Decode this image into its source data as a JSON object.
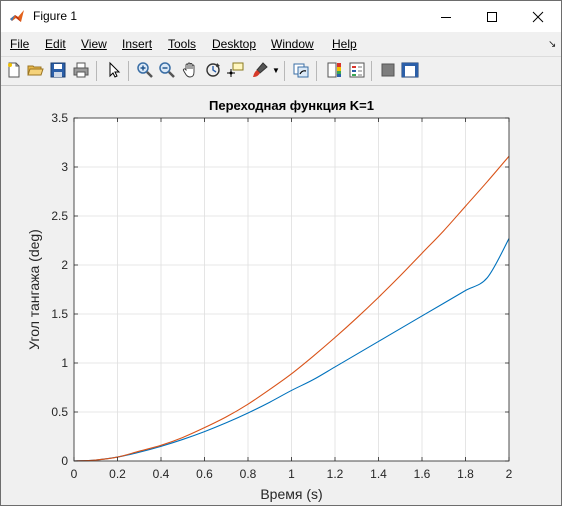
{
  "window": {
    "title": "Figure 1"
  },
  "menu": {
    "items": [
      "File",
      "Edit",
      "View",
      "Insert",
      "Tools",
      "Desktop",
      "Window",
      "Help"
    ]
  },
  "toolbar": {
    "icons": [
      "new-figure-icon",
      "open-file-icon",
      "save-icon",
      "print-icon",
      "pointer-icon",
      "zoom-in-icon",
      "zoom-out-icon",
      "pan-icon",
      "rotate-3d-icon",
      "data-cursor-icon",
      "brush-icon",
      "link-plot-icon",
      "colorbar-icon",
      "legend-icon",
      "hide-plot-tools-icon",
      "show-plot-tools-icon"
    ]
  },
  "colors": {
    "series_1": "#0072bd",
    "series_2": "#d95319",
    "grid": "#dfdfdf"
  },
  "chart_data": {
    "type": "line",
    "title": "Переходная функция K=1",
    "xlabel": "Время (s)",
    "ylabel": "Угол тангажа (deg)",
    "xlim": [
      0,
      2
    ],
    "ylim": [
      0,
      3.5
    ],
    "xticks": [
      "0",
      "0.2",
      "0.4",
      "0.6",
      "0.8",
      "1",
      "1.2",
      "1.4",
      "1.6",
      "1.8",
      "2"
    ],
    "yticks": [
      "0",
      "0.5",
      "1",
      "1.5",
      "2",
      "2.5",
      "3",
      "3.5"
    ],
    "grid": true,
    "legend": "none",
    "series": [
      {
        "color": "#0072bd",
        "x": [
          0,
          0.1,
          0.2,
          0.3,
          0.4,
          0.5,
          0.6,
          0.7,
          0.8,
          0.9,
          1.0,
          1.1,
          1.2,
          1.3,
          1.4,
          1.5,
          1.6,
          1.7,
          1.8,
          1.9,
          2.0
        ],
        "y": [
          0,
          0.01,
          0.04,
          0.09,
          0.15,
          0.22,
          0.3,
          0.39,
          0.49,
          0.6,
          0.72,
          0.83,
          0.96,
          1.09,
          1.22,
          1.35,
          1.48,
          1.61,
          1.74,
          1.87,
          2.27
        ]
      },
      {
        "color": "#d95319",
        "x": [
          0,
          0.1,
          0.2,
          0.3,
          0.4,
          0.5,
          0.6,
          0.7,
          0.8,
          0.9,
          1.0,
          1.1,
          1.2,
          1.3,
          1.4,
          1.5,
          1.6,
          1.7,
          1.8,
          1.9,
          2.0
        ],
        "y": [
          0,
          0.01,
          0.04,
          0.1,
          0.16,
          0.24,
          0.34,
          0.45,
          0.58,
          0.73,
          0.89,
          1.07,
          1.26,
          1.46,
          1.67,
          1.89,
          2.12,
          2.35,
          2.6,
          2.85,
          3.11
        ]
      }
    ]
  }
}
